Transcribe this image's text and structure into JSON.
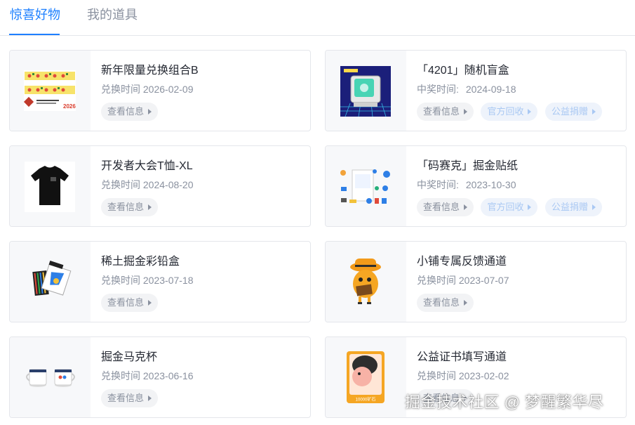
{
  "tabs": [
    {
      "label": "惊喜好物",
      "active": true
    },
    {
      "label": "我的道具",
      "active": false
    }
  ],
  "accent_color": "#1e80ff",
  "items": [
    {
      "title": "新年限量兑换组合B",
      "meta_label": "兑换时间",
      "meta_value": "2026-02-09",
      "buttons": [
        "查看信息"
      ]
    },
    {
      "title": "「4201」随机盲盒",
      "meta_label": "中奖时间:",
      "meta_value": "2024-09-18",
      "buttons": [
        "查看信息",
        "官方回收",
        "公益捐赠"
      ]
    },
    {
      "title": "开发者大会T恤-XL",
      "meta_label": "兑换时间",
      "meta_value": "2024-08-20",
      "buttons": [
        "查看信息"
      ]
    },
    {
      "title": "「码赛克」掘金贴纸",
      "meta_label": "中奖时间:",
      "meta_value": "2023-10-30",
      "buttons": [
        "查看信息",
        "官方回收",
        "公益捐赠"
      ]
    },
    {
      "title": "稀土掘金彩铅盒",
      "meta_label": "兑换时间",
      "meta_value": "2023-07-18",
      "buttons": [
        "查看信息"
      ]
    },
    {
      "title": "小铺专属反馈通道",
      "meta_label": "兑换时间",
      "meta_value": "2023-07-07",
      "buttons": [
        "查看信息"
      ]
    },
    {
      "title": "掘金马克杯",
      "meta_label": "兑换时间",
      "meta_value": "2023-06-16",
      "buttons": [
        "查看信息"
      ]
    },
    {
      "title": "公益证书填写通道",
      "meta_label": "兑换时间",
      "meta_value": "2023-02-02",
      "buttons": [
        "查看信息"
      ]
    }
  ],
  "thumb_texts": {
    "newyear": "2026",
    "cert": "10000矿石"
  },
  "watermark": "掘金技术社区 @ 梦醒繁华尽"
}
